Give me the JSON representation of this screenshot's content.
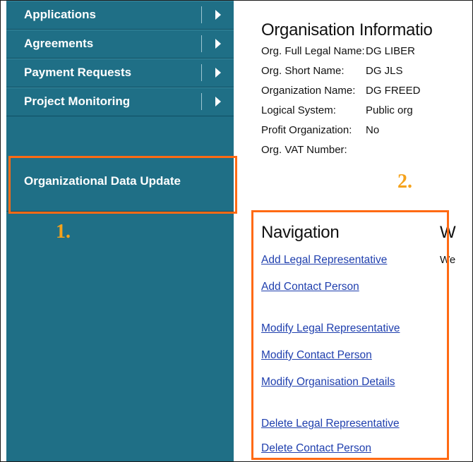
{
  "sidebar": {
    "items": [
      {
        "label": "Applications"
      },
      {
        "label": "Agreements"
      },
      {
        "label": "Payment Requests"
      },
      {
        "label": "Project Monitoring"
      }
    ],
    "active_item": {
      "label": "Organizational Data Update"
    }
  },
  "annotations": {
    "step1": "1.",
    "step2": "2.",
    "color": "#ff6a13"
  },
  "org_info": {
    "title": "Organisation Informatio",
    "rows": [
      {
        "label": "Org. Full Legal Name:",
        "value": "DG LIBER"
      },
      {
        "label": "Org. Short Name:",
        "value": "DG JLS"
      },
      {
        "label": "Organization Name:",
        "value": "DG FREED"
      },
      {
        "label": "Logical System:",
        "value": "Public org"
      },
      {
        "label": "Profit Organization:",
        "value": "No"
      },
      {
        "label": "Org. VAT Number:",
        "value": ""
      }
    ]
  },
  "navigation": {
    "title": "Navigation",
    "links": [
      "Add Legal Representative",
      "Add Contact Person",
      "Modify Legal Representative",
      "Modify Contact Person",
      "Modify Organisation Details",
      "Delete Legal Representative",
      "Delete Contact Person"
    ]
  },
  "welcome": {
    "title": "W",
    "text": "We"
  },
  "colors": {
    "sidebar": "#1f6f86",
    "link": "#1f3fae",
    "highlight": "#ff6a13",
    "step_number": "#f5a21b"
  }
}
